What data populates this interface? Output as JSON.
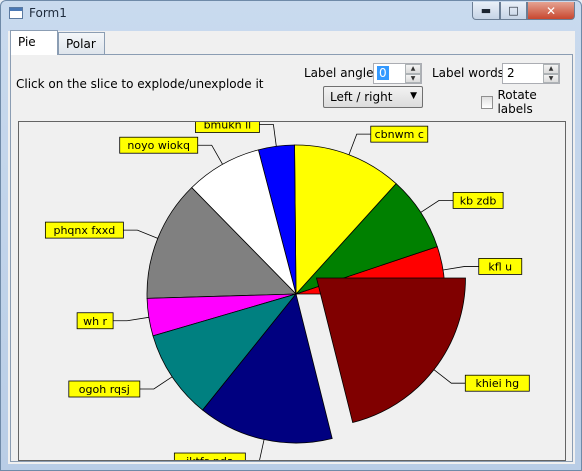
{
  "window": {
    "title": "Form1"
  },
  "tabs": [
    {
      "label": "Pie",
      "active": true
    },
    {
      "label": "Polar",
      "active": false
    }
  ],
  "controls": {
    "instruction": "Click on the slice to explode/unexplode it",
    "label_angle_label": "Label angle",
    "label_angle_value": "0",
    "label_words_label": "Label words",
    "label_words_value": "2",
    "alignment_selected": "Left / right",
    "rotate_labels_label": "Rotate labels",
    "rotate_labels_checked": false
  },
  "chart_data": {
    "type": "pie",
    "title": "",
    "slices": [
      {
        "label": "kfl u",
        "value": 16.5,
        "color": "#ff0000",
        "exploded": false
      },
      {
        "label": "kb zdb",
        "value": 26,
        "color": "#008000",
        "exploded": false
      },
      {
        "label": "cbnwm c",
        "value": 38,
        "color": "#ffff00",
        "exploded": false
      },
      {
        "label": "bmukn ll",
        "value": 12.5,
        "color": "#0000ff",
        "exploded": false
      },
      {
        "label": "noyo wiokq",
        "value": 26.5,
        "color": "#ffffff",
        "exploded": false
      },
      {
        "label": "phqnx fxxd",
        "value": 42,
        "color": "#808080",
        "exploded": false
      },
      {
        "label": "wh r",
        "value": 13,
        "color": "#ff00ff",
        "exploded": false
      },
      {
        "label": "ogoh rqsj",
        "value": 31,
        "color": "#008080",
        "exploded": false
      },
      {
        "label": "iktfs pda",
        "value": 47,
        "color": "#000080",
        "exploded": false
      },
      {
        "label": "khiei hg",
        "value": 67.5,
        "color": "#800000",
        "exploded": true
      }
    ]
  }
}
